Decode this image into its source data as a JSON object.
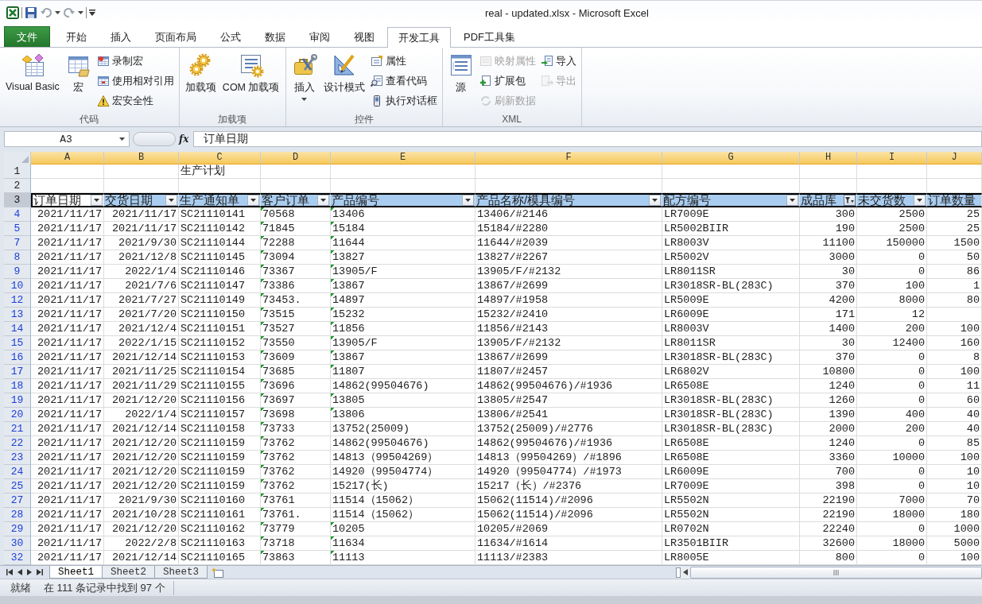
{
  "window": {
    "title": "real - updated.xlsx  -  Microsoft Excel"
  },
  "ribbon_tabs": [
    {
      "label": "文件",
      "kind": "file",
      "selected": false
    },
    {
      "label": "开始",
      "kind": "tab",
      "selected": false
    },
    {
      "label": "插入",
      "kind": "tab",
      "selected": false
    },
    {
      "label": "页面布局",
      "kind": "tab",
      "selected": false
    },
    {
      "label": "公式",
      "kind": "tab",
      "selected": false
    },
    {
      "label": "数据",
      "kind": "tab",
      "selected": false
    },
    {
      "label": "审阅",
      "kind": "tab",
      "selected": false
    },
    {
      "label": "视图",
      "kind": "tab",
      "selected": false
    },
    {
      "label": "开发工具",
      "kind": "tab",
      "selected": true
    },
    {
      "label": "PDF工具集",
      "kind": "tab",
      "selected": false
    }
  ],
  "ribbon_groups": [
    {
      "label": "代码",
      "items": [
        {
          "label": "Visual Basic",
          "kind": "large",
          "disabled": false
        },
        {
          "label": "宏",
          "kind": "large",
          "disabled": false
        },
        {
          "label": "录制宏",
          "kind": "small",
          "disabled": false
        },
        {
          "label": "使用相对引用",
          "kind": "small",
          "disabled": false
        },
        {
          "label": "宏安全性",
          "kind": "small",
          "disabled": false
        }
      ]
    },
    {
      "label": "加载项",
      "items": [
        {
          "label": "加载项",
          "kind": "large",
          "disabled": false
        },
        {
          "label": "COM 加载项",
          "kind": "large",
          "disabled": false
        }
      ]
    },
    {
      "label": "控件",
      "items": [
        {
          "label": "插入",
          "kind": "large",
          "disabled": false,
          "dropdown": true
        },
        {
          "label": "设计模式",
          "kind": "large",
          "disabled": false
        },
        {
          "label": "属性",
          "kind": "small",
          "disabled": false
        },
        {
          "label": "查看代码",
          "kind": "small",
          "disabled": false
        },
        {
          "label": "执行对话框",
          "kind": "small",
          "disabled": false
        }
      ]
    },
    {
      "label": "XML",
      "items": [
        {
          "label": "源",
          "kind": "large",
          "disabled": false
        },
        {
          "label": "映射属性",
          "kind": "small",
          "disabled": true
        },
        {
          "label": "扩展包",
          "kind": "small",
          "disabled": false
        },
        {
          "label": "刷新数据",
          "kind": "small",
          "disabled": true
        },
        {
          "label": "导入",
          "kind": "small",
          "disabled": false
        },
        {
          "label": "导出",
          "kind": "small",
          "disabled": true
        }
      ]
    }
  ],
  "formula_bar": {
    "name_box": "A3",
    "function_label": "fx",
    "formula": "订单日期"
  },
  "sheet": {
    "columns": [
      {
        "letter": "A",
        "kind": "date",
        "selected": true
      },
      {
        "letter": "B",
        "kind": "date",
        "selected": true
      },
      {
        "letter": "C",
        "kind": "text",
        "selected": true
      },
      {
        "letter": "D",
        "kind": "text",
        "selected": true
      },
      {
        "letter": "E",
        "kind": "text",
        "selected": true
      },
      {
        "letter": "F",
        "kind": "text",
        "selected": true
      },
      {
        "letter": "G",
        "kind": "text",
        "selected": true
      },
      {
        "letter": "H",
        "kind": "number",
        "selected": true
      },
      {
        "letter": "I",
        "kind": "number",
        "selected": true
      },
      {
        "letter": "J",
        "kind": "number",
        "selected": true
      }
    ],
    "rows": [
      {
        "number": "1",
        "kind": "plain",
        "selected": false,
        "cells": [
          null,
          null,
          "生产计划",
          null,
          null,
          null,
          null,
          null,
          null,
          null
        ]
      },
      {
        "number": "2",
        "kind": "plain",
        "selected": false,
        "cells": [
          null,
          null,
          null,
          null,
          null,
          null,
          null,
          null,
          null,
          null
        ]
      },
      {
        "number": "3",
        "kind": "header",
        "selected": true,
        "cells": [
          {
            "text": "订单日期",
            "dropdown": true,
            "filtered": false,
            "active": true
          },
          {
            "text": "交货日期",
            "dropdown": true,
            "filtered": false,
            "active": false
          },
          {
            "text": "生产通知单",
            "dropdown": true,
            "filtered": false,
            "active": false
          },
          {
            "text": "客户订单",
            "dropdown": true,
            "filtered": false,
            "active": false
          },
          {
            "text": "产品编号",
            "dropdown": true,
            "filtered": false,
            "active": false
          },
          {
            "text": "产品名称/模具编号",
            "dropdown": true,
            "filtered": false,
            "active": false
          },
          {
            "text": "配方编号",
            "dropdown": true,
            "filtered": false,
            "active": false
          },
          {
            "text": "成品库",
            "dropdown": true,
            "filtered": true,
            "active": false
          },
          {
            "text": "未交货数",
            "dropdown": true,
            "filtered": false,
            "active": false
          },
          {
            "text": "订单数量",
            "active": false
          }
        ]
      },
      {
        "number": "4",
        "kind": "data",
        "selected": false,
        "order_no_flagged": true,
        "product_no_flagged": true,
        "cells": [
          "2021/11/17",
          "2021/11/17",
          "SC21110141",
          "70568",
          "13406",
          "13406/#2146",
          "LR7009E",
          "300",
          "2500",
          "25"
        ]
      },
      {
        "number": "5",
        "kind": "data",
        "selected": false,
        "order_no_flagged": true,
        "product_no_flagged": true,
        "cells": [
          "2021/11/17",
          "2021/11/17",
          "SC21110142",
          "71845",
          "15184",
          "15184/#2280",
          "LR5002BIIR",
          "190",
          "2500",
          "25"
        ]
      },
      {
        "number": "7",
        "kind": "data",
        "selected": false,
        "order_no_flagged": true,
        "product_no_flagged": true,
        "cells": [
          "2021/11/17",
          "2021/9/30",
          "SC21110144",
          "72288",
          "11644",
          "11644/#2039",
          "LR8003V",
          "11100",
          "150000",
          "1500"
        ]
      },
      {
        "number": "8",
        "kind": "data",
        "selected": false,
        "order_no_flagged": true,
        "product_no_flagged": true,
        "cells": [
          "2021/11/17",
          "2021/12/8",
          "SC21110145",
          "73094",
          "13827",
          "13827/#2267",
          "LR5002V",
          "3000",
          "0",
          "50"
        ]
      },
      {
        "number": "9",
        "kind": "data",
        "selected": false,
        "order_no_flagged": true,
        "product_no_flagged": true,
        "cells": [
          "2021/11/17",
          "2022/1/4",
          "SC21110146",
          "73367",
          "13905/F",
          "13905/F/#2132",
          "LR8011SR",
          "30",
          "0",
          "86"
        ]
      },
      {
        "number": "10",
        "kind": "data",
        "selected": false,
        "order_no_flagged": true,
        "product_no_flagged": true,
        "cells": [
          "2021/11/17",
          "2021/7/6",
          "SC21110147",
          "73386",
          "13867",
          "13867/#2699",
          "LR3018SR-BL(283C)",
          "370",
          "100",
          "1"
        ]
      },
      {
        "number": "12",
        "kind": "data",
        "selected": false,
        "order_no_flagged": true,
        "product_no_flagged": true,
        "cells": [
          "2021/11/17",
          "2021/7/27",
          "SC21110149",
          "73453.",
          "14897",
          "14897/#1958",
          "LR5009E",
          "4200",
          "8000",
          "80"
        ]
      },
      {
        "number": "13",
        "kind": "data",
        "selected": false,
        "order_no_flagged": true,
        "product_no_flagged": true,
        "cells": [
          "2021/11/17",
          "2021/7/20",
          "SC21110150",
          "73515",
          "15232",
          "15232/#2410",
          "LR6009E",
          "171",
          "12",
          null
        ]
      },
      {
        "number": "14",
        "kind": "data",
        "selected": false,
        "order_no_flagged": true,
        "product_no_flagged": true,
        "cells": [
          "2021/11/17",
          "2021/12/4",
          "SC21110151",
          "73527",
          "11856",
          "11856/#2143",
          "LR8003V",
          "1400",
          "200",
          "100"
        ]
      },
      {
        "number": "15",
        "kind": "data",
        "selected": false,
        "order_no_flagged": true,
        "product_no_flagged": true,
        "cells": [
          "2021/11/17",
          "2022/1/15",
          "SC21110152",
          "73550",
          "13905/F",
          "13905/F/#2132",
          "LR8011SR",
          "30",
          "12400",
          "160"
        ]
      },
      {
        "number": "16",
        "kind": "data",
        "selected": false,
        "order_no_flagged": true,
        "product_no_flagged": true,
        "cells": [
          "2021/11/17",
          "2021/12/14",
          "SC21110153",
          "73609",
          "13867",
          "13867/#2699",
          "LR3018SR-BL(283C)",
          "370",
          "0",
          "8"
        ]
      },
      {
        "number": "17",
        "kind": "data",
        "selected": false,
        "order_no_flagged": true,
        "product_no_flagged": true,
        "cells": [
          "2021/11/17",
          "2021/11/25",
          "SC21110154",
          "73685",
          "11807",
          "11807/#2457",
          "LR6802V",
          "10800",
          "0",
          "100"
        ]
      },
      {
        "number": "18",
        "kind": "data",
        "selected": false,
        "order_no_flagged": true,
        "product_no_flagged": false,
        "cells": [
          "2021/11/17",
          "2021/11/29",
          "SC21110155",
          "73696",
          "14862(99504676)",
          "14862(99504676)/#1936",
          "LR6508E",
          "1240",
          "0",
          "11"
        ]
      },
      {
        "number": "19",
        "kind": "data",
        "selected": false,
        "order_no_flagged": true,
        "product_no_flagged": true,
        "cells": [
          "2021/11/17",
          "2021/12/20",
          "SC21110156",
          "73697",
          "13805",
          "13805/#2547",
          "LR3018SR-BL(283C)",
          "1260",
          "0",
          "60"
        ]
      },
      {
        "number": "20",
        "kind": "data",
        "selected": false,
        "order_no_flagged": true,
        "product_no_flagged": true,
        "cells": [
          "2021/11/17",
          "2022/1/4",
          "SC21110157",
          "73698",
          "13806",
          "13806/#2541",
          "LR3018SR-BL(283C)",
          "1390",
          "400",
          "40"
        ]
      },
      {
        "number": "21",
        "kind": "data",
        "selected": false,
        "order_no_flagged": true,
        "product_no_flagged": false,
        "cells": [
          "2021/11/17",
          "2021/12/14",
          "SC21110158",
          "73733",
          "13752(25009)",
          "13752(25009)/#2776",
          "LR3018SR-BL(283C)",
          "2000",
          "200",
          "40"
        ]
      },
      {
        "number": "22",
        "kind": "data",
        "selected": false,
        "order_no_flagged": true,
        "product_no_flagged": false,
        "cells": [
          "2021/11/17",
          "2021/12/20",
          "SC21110159",
          "73762",
          "14862(99504676)",
          "14862(99504676)/#1936",
          "LR6508E",
          "1240",
          "0",
          "85"
        ]
      },
      {
        "number": "23",
        "kind": "data",
        "selected": false,
        "order_no_flagged": true,
        "product_no_flagged": false,
        "cells": [
          "2021/11/17",
          "2021/12/20",
          "SC21110159",
          "73762",
          "14813（99504269）",
          "14813（99504269）/#1896",
          "LR6508E",
          "3360",
          "10000",
          "100"
        ]
      },
      {
        "number": "24",
        "kind": "data",
        "selected": false,
        "order_no_flagged": true,
        "product_no_flagged": false,
        "cells": [
          "2021/11/17",
          "2021/12/20",
          "SC21110159",
          "73762",
          "14920（99504774）",
          "14920（99504774）/#1973",
          "LR6009E",
          "700",
          "0",
          "10"
        ]
      },
      {
        "number": "25",
        "kind": "data",
        "selected": false,
        "order_no_flagged": true,
        "product_no_flagged": false,
        "cells": [
          "2021/11/17",
          "2021/12/20",
          "SC21110159",
          "73762",
          "15217(长)",
          "15217（长）/#2376",
          "LR7009E",
          "398",
          "0",
          "10"
        ]
      },
      {
        "number": "27",
        "kind": "data",
        "selected": false,
        "order_no_flagged": true,
        "product_no_flagged": false,
        "cells": [
          "2021/11/17",
          "2021/9/30",
          "SC21110160",
          "73761",
          "11514（15062）",
          "15062(11514)/#2096",
          "LR5502N",
          "22190",
          "7000",
          "70"
        ]
      },
      {
        "number": "28",
        "kind": "data",
        "selected": false,
        "order_no_flagged": true,
        "product_no_flagged": false,
        "cells": [
          "2021/11/17",
          "2021/10/28",
          "SC21110161",
          "73761.",
          "11514（15062）",
          "15062(11514)/#2096",
          "LR5502N",
          "22190",
          "18000",
          "180"
        ]
      },
      {
        "number": "29",
        "kind": "data",
        "selected": false,
        "order_no_flagged": true,
        "product_no_flagged": true,
        "cells": [
          "2021/11/17",
          "2021/12/20",
          "SC21110162",
          "73779",
          "10205",
          "10205/#2069",
          "LR0702N",
          "22240",
          "0",
          "1000"
        ]
      },
      {
        "number": "30",
        "kind": "data",
        "selected": false,
        "order_no_flagged": true,
        "product_no_flagged": true,
        "cells": [
          "2021/11/17",
          "2022/2/8",
          "SC21110163",
          "73718",
          "11634",
          "11634/#1614",
          "LR3501BIIR",
          "32600",
          "18000",
          "5000"
        ]
      },
      {
        "number": "32",
        "kind": "data",
        "selected": false,
        "order_no_flagged": true,
        "product_no_flagged": true,
        "cells": [
          "2021/11/17",
          "2021/12/14",
          "SC21110165",
          "73863",
          "11113",
          "11113/#2383",
          "LR8005E",
          "800",
          "0",
          "100"
        ]
      }
    ]
  },
  "sheet_tabs": [
    {
      "label": "Sheet1",
      "selected": true
    },
    {
      "label": "Sheet2",
      "selected": false
    },
    {
      "label": "Sheet3",
      "selected": false
    }
  ],
  "status_bar": {
    "mode": "就绪",
    "message": "在 111 条记录中找到 97 个"
  }
}
